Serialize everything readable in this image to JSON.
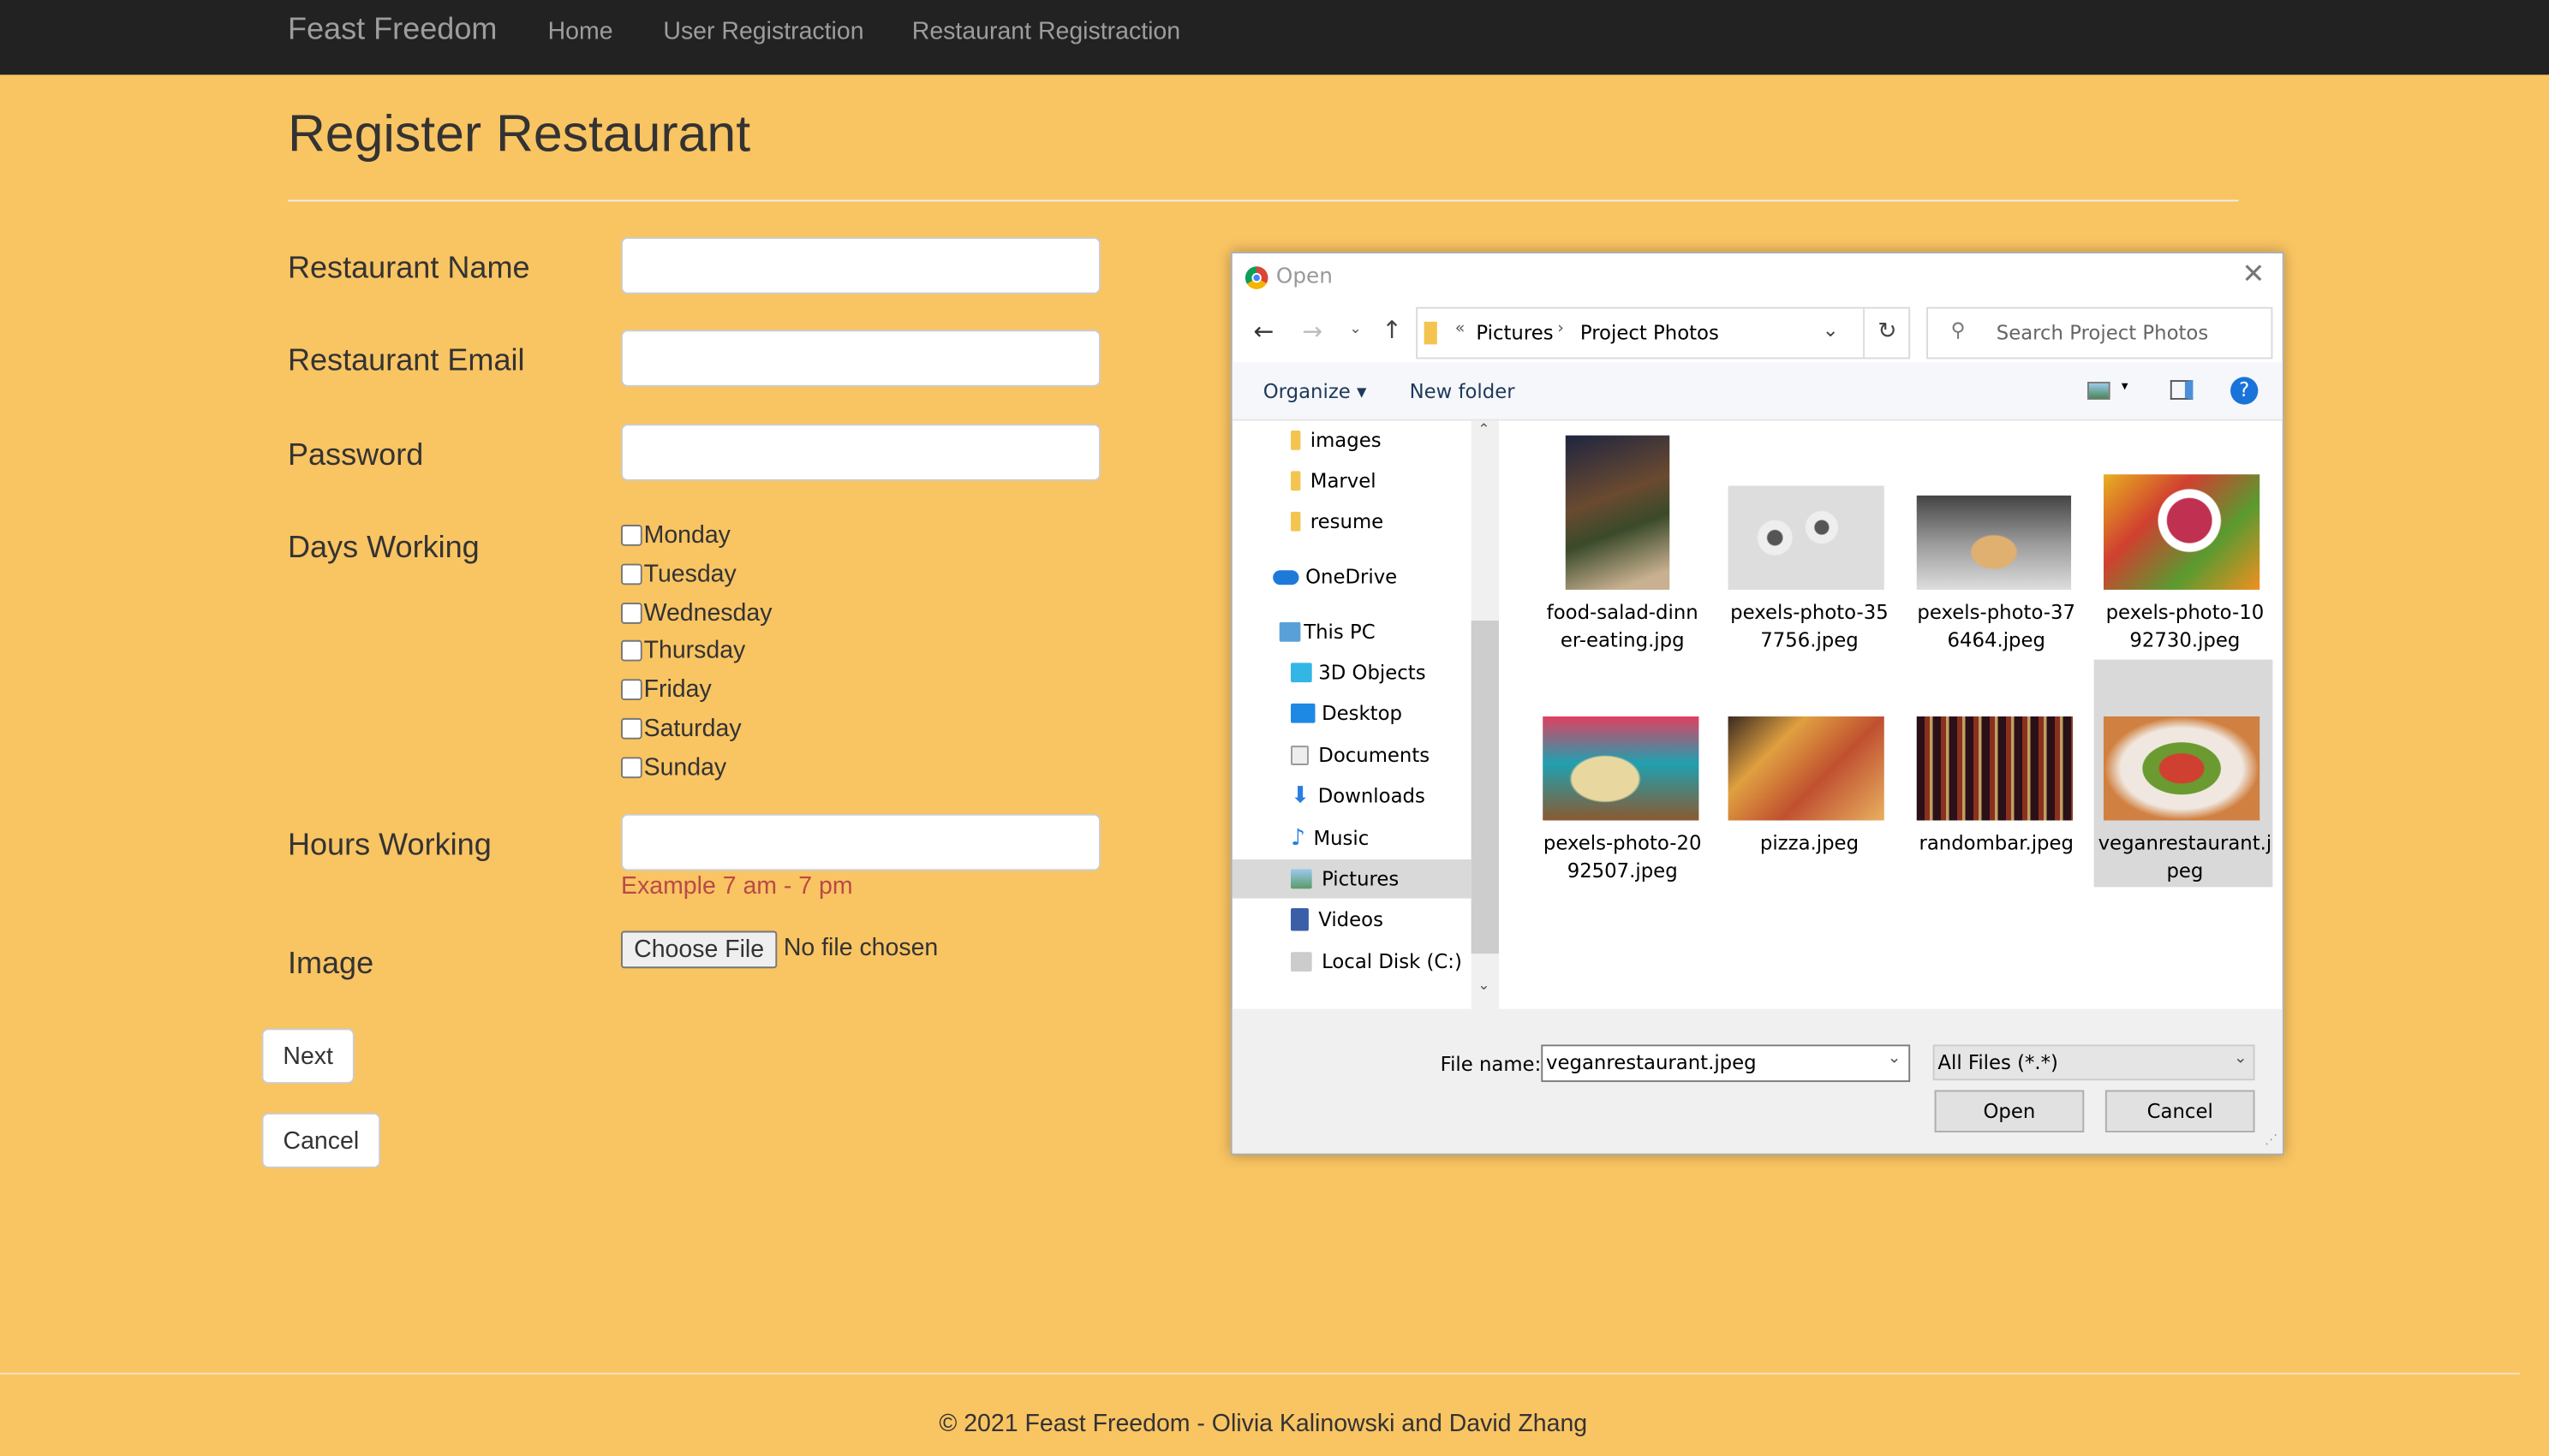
{
  "nav": {
    "brand": "Feast Freedom",
    "links": [
      "Home",
      "User Registraction",
      "Restaurant Registraction"
    ]
  },
  "page": {
    "title": "Register Restaurant",
    "labels": {
      "name": "Restaurant Name",
      "email": "Restaurant Email",
      "password": "Password",
      "days": "Days Working",
      "hours": "Hours Working",
      "image": "Image"
    },
    "days": [
      "Monday",
      "Tuesday",
      "Wednesday",
      "Thursday",
      "Friday",
      "Saturday",
      "Sunday"
    ],
    "hours_hint": "Example 7 am - 7 pm",
    "file_button": "Choose File",
    "file_status": "No file chosen",
    "next": "Next",
    "cancel": "Cancel"
  },
  "footer": "© 2021 Feast Freedom - Olivia Kalinowski and David Zhang",
  "dialog": {
    "title": "Open",
    "breadcrumb": [
      "«",
      "Pictures",
      "Project Photos"
    ],
    "search_placeholder": "Search Project Photos",
    "organize": "Organize",
    "new_folder": "New folder",
    "nav_items": [
      "images",
      "Marvel",
      "resume",
      "OneDrive",
      "This PC",
      "3D Objects",
      "Desktop",
      "Documents",
      "Downloads",
      "Music",
      "Pictures",
      "Videos",
      "Local Disk (C:)"
    ],
    "files": [
      [
        "food-salad-dinn",
        "er-eating.jpg"
      ],
      [
        "pexels-photo-35",
        "7756.jpeg"
      ],
      [
        "pexels-photo-37",
        "6464.jpeg"
      ],
      [
        "pexels-photo-10",
        "92730.jpeg"
      ],
      [
        "pexels-photo-20",
        "92507.jpeg"
      ],
      [
        "pizza.jpeg",
        ""
      ],
      [
        "randombar.jpeg",
        ""
      ],
      [
        "veganrestaurant.j",
        "peg"
      ]
    ],
    "file_name_label": "File name:",
    "file_name": "veganrestaurant.jpeg",
    "filter": "All Files (*.*)",
    "open": "Open",
    "cancel": "Cancel"
  }
}
